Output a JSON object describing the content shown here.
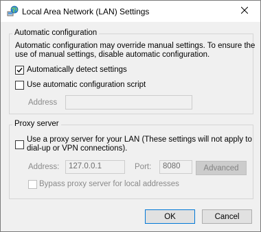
{
  "window": {
    "title": "Local Area Network (LAN) Settings",
    "close_glyph": "✕"
  },
  "auto_config": {
    "group_label": "Automatic configuration",
    "description_line1": "Automatic configuration may override manual settings.  To ensure the",
    "description_line2": "use of manual settings, disable automatic configuration.",
    "auto_detect_label": "Automatically detect settings",
    "auto_detect_checked": true,
    "use_script_label": "Use automatic configuration script",
    "use_script_checked": false,
    "address_label": "Address",
    "address_value": ""
  },
  "proxy": {
    "group_label": "Proxy server",
    "use_proxy_line1": "Use a proxy server for your LAN (These settings will not apply to",
    "use_proxy_line2": "dial-up or VPN connections).",
    "use_proxy_checked": false,
    "address_label": "Address:",
    "address_value": "127.0.0.1",
    "port_label": "Port:",
    "port_value": "8080",
    "advanced_label": "Advanced",
    "bypass_label": "Bypass proxy server for local addresses",
    "bypass_checked": false
  },
  "buttons": {
    "ok_label": "OK",
    "cancel_label": "Cancel"
  },
  "colors": {
    "accent": "#0078d7",
    "disabled_text": "#8a8a8a"
  },
  "icons": {
    "title": "network-globe-icon",
    "close": "close-icon",
    "check": "checkmark-icon"
  }
}
